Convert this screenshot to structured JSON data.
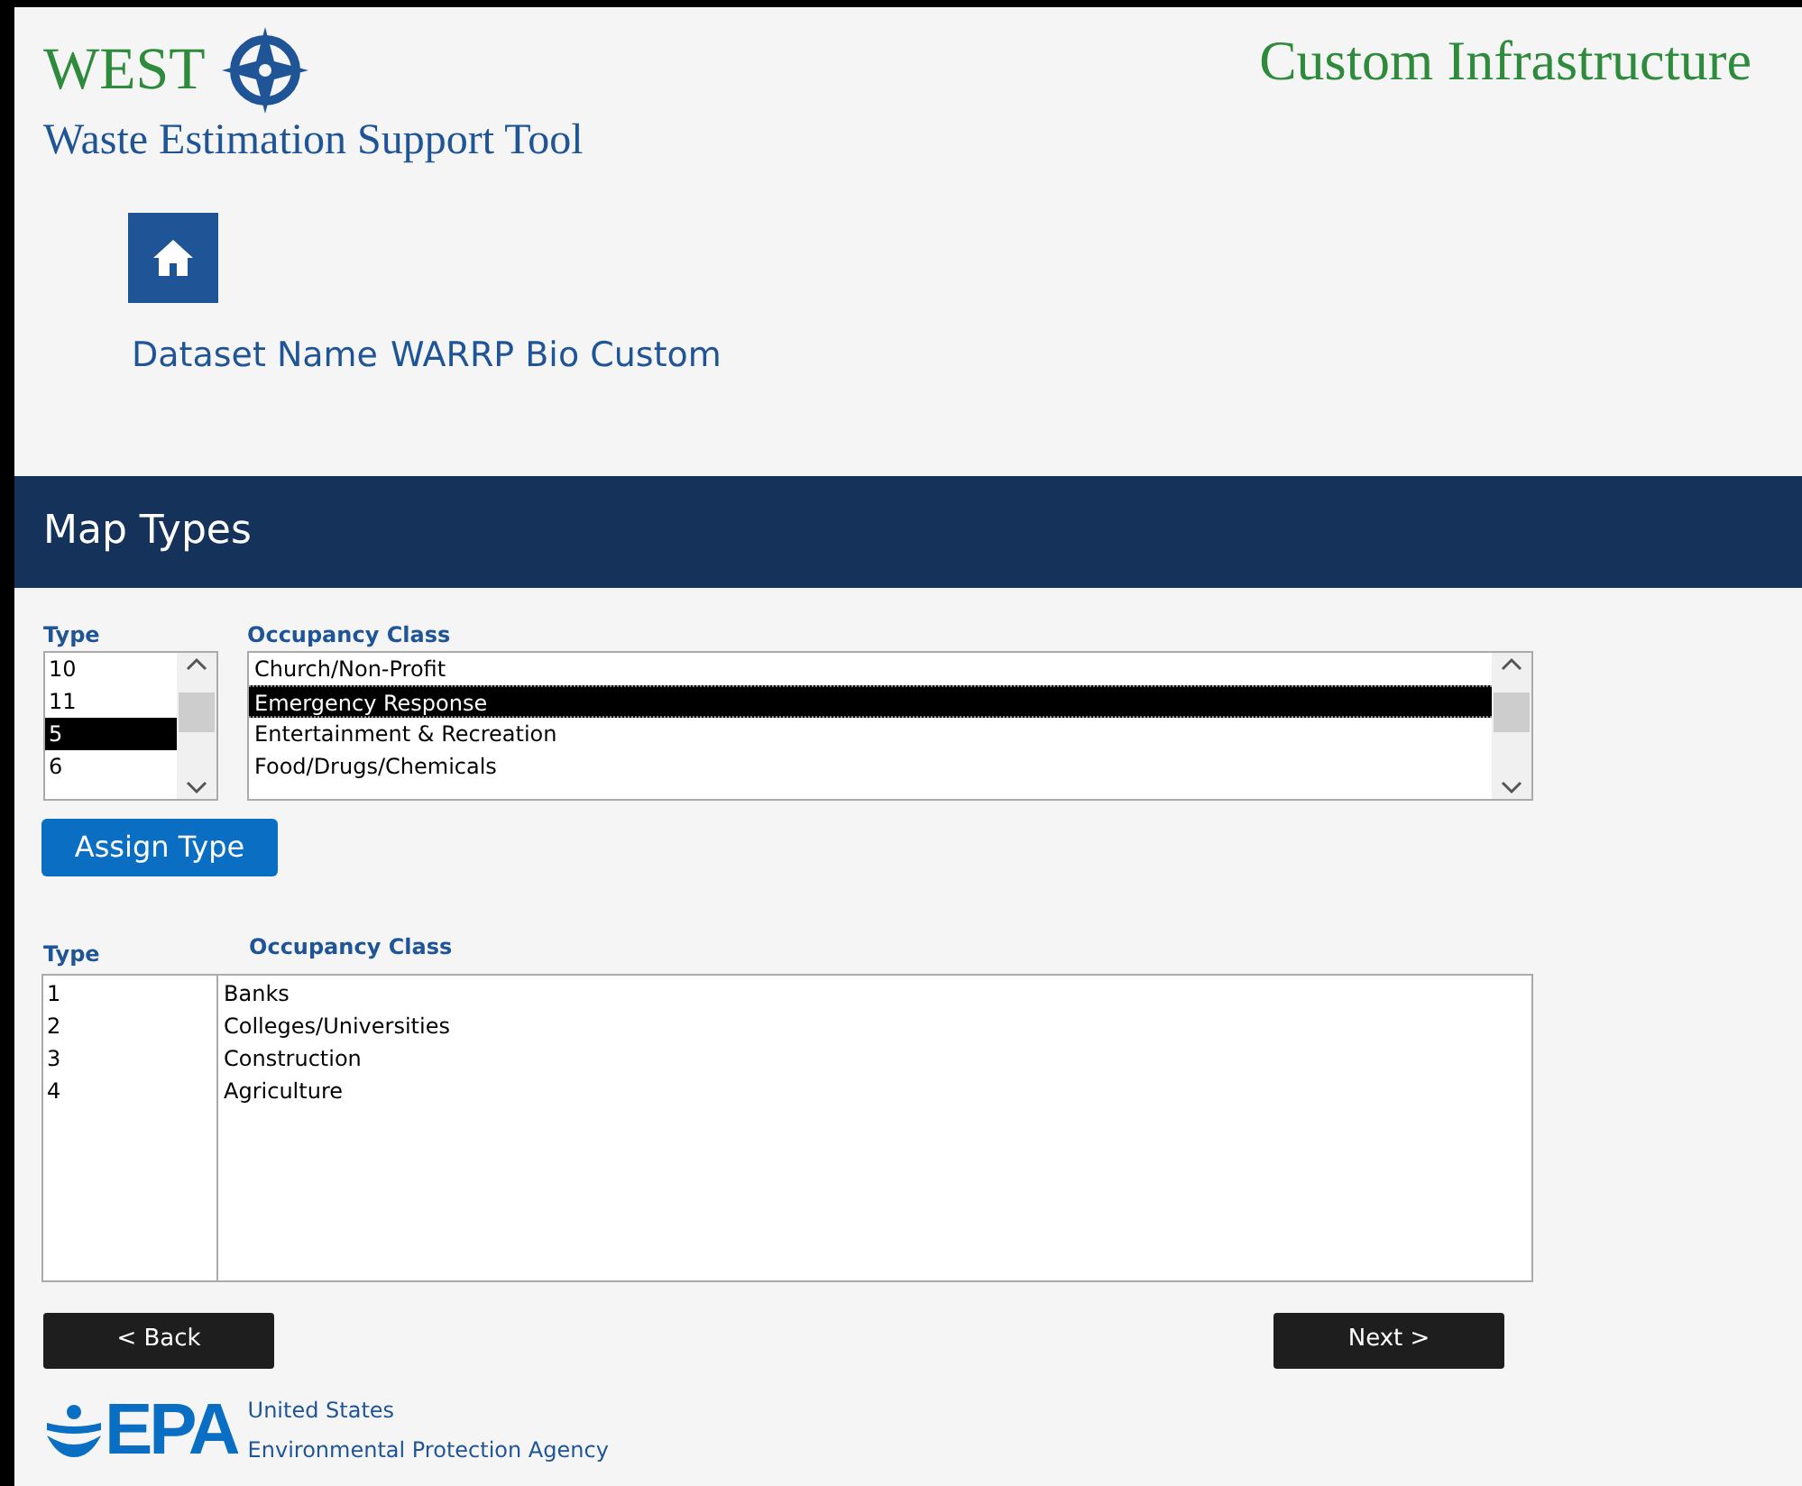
{
  "header": {
    "logo_text": "WEST",
    "subtitle": "Waste Estimation Support Tool",
    "page_title": "Custom Infrastructure"
  },
  "dataset": {
    "label": "Dataset Name",
    "value": "WARRP Bio Custom"
  },
  "section": {
    "title": "Map Types"
  },
  "picker": {
    "type_label": "Type",
    "class_label": "Occupancy Class",
    "types": [
      {
        "text": "10",
        "selected": false
      },
      {
        "text": "11",
        "selected": false
      },
      {
        "text": "5",
        "selected": true
      },
      {
        "text": "6",
        "selected": false
      }
    ],
    "classes": [
      {
        "text": "Church/Non-Profit",
        "selected": false
      },
      {
        "text": "Emergency Response",
        "selected": true
      },
      {
        "text": "Entertainment & Recreation",
        "selected": false
      },
      {
        "text": "Food/Drugs/Chemicals",
        "selected": false
      }
    ]
  },
  "assign_button": "Assign Type",
  "assigned": {
    "type_label": "Type",
    "class_label": "Occupancy Class",
    "rows": [
      {
        "type": "1",
        "class": "Banks"
      },
      {
        "type": "2",
        "class": "Colleges/Universities"
      },
      {
        "type": "3",
        "class": "Construction"
      },
      {
        "type": "4",
        "class": "Agriculture"
      }
    ]
  },
  "buttons": {
    "back": "< Back",
    "next": "Next >"
  },
  "footer": {
    "logo_text": "EPA",
    "line_1": "United States",
    "line_2": "Environmental Protection Agency"
  }
}
